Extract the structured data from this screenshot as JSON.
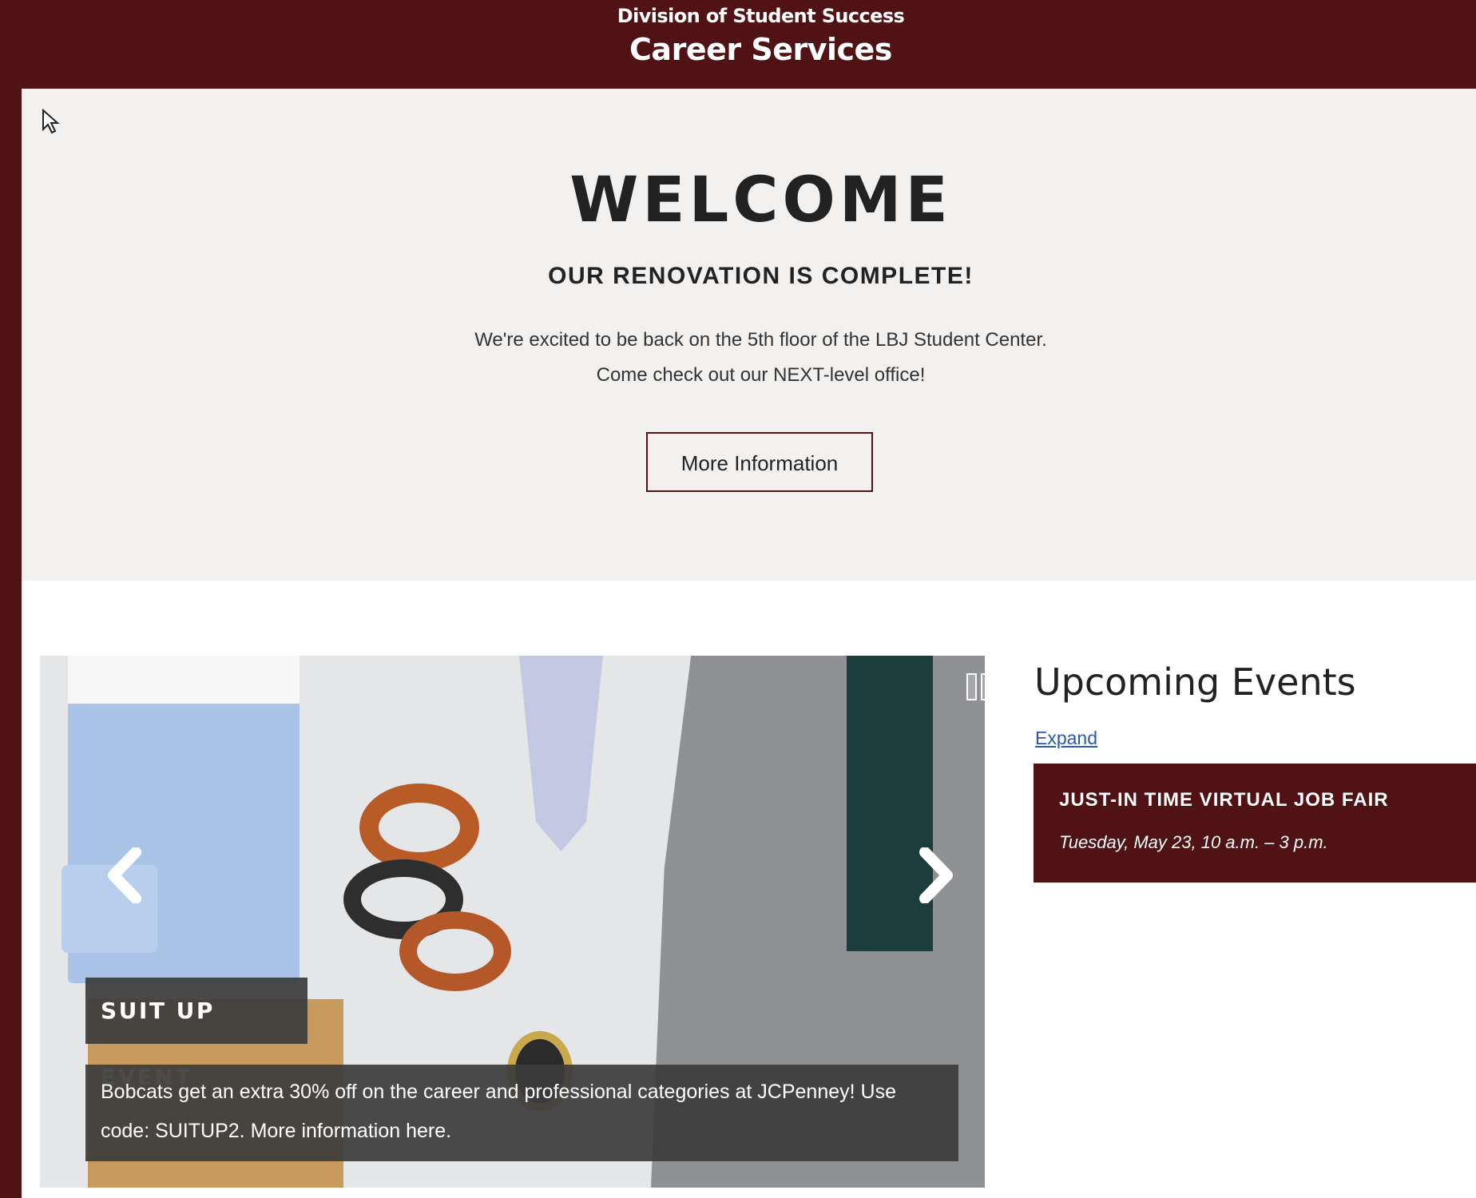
{
  "header": {
    "division": "Division of Student Success",
    "unit": "Career Services"
  },
  "hero": {
    "title": "WELCOME",
    "subtitle": "OUR RENOVATION IS COMPLETE!",
    "line1": "We're excited to be back on the 5th floor of the LBJ Student Center.",
    "line2": "Come check out our NEXT-level office!",
    "button_label": "More Information"
  },
  "slide": {
    "title": "SUIT UP EVENT",
    "text": "Bobcats get an extra 30% off on the career and professional categories at JCPenney! Use code: SUITUP2. More information here."
  },
  "events": {
    "title": "Upcoming Events",
    "expand_label": "Expand",
    "items": [
      {
        "name": "JUST-IN TIME VIRTUAL JOB FAIR",
        "time": "Tuesday, May 23, 10 a.m. – 3 p.m."
      }
    ]
  },
  "icons": {
    "prev": "chevron-left-icon",
    "next": "chevron-right-icon",
    "pause": "pause-icon",
    "cursor": "mouse-cursor-icon"
  },
  "colors": {
    "brand": "#501214",
    "hero_bg": "#f3f1ef",
    "link": "#2b5aa4"
  }
}
